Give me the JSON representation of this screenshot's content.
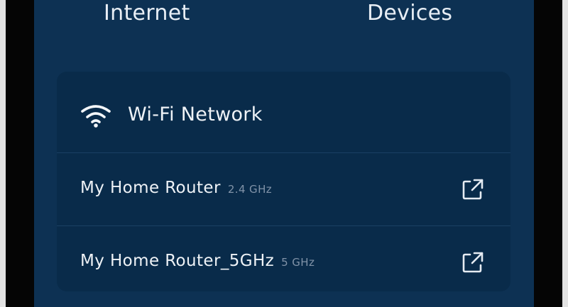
{
  "header": {
    "tabs": [
      {
        "label": "Internet"
      },
      {
        "label": "Devices"
      }
    ]
  },
  "wifi_card": {
    "title": "Wi-Fi Network",
    "icon": "wifi-icon",
    "networks": [
      {
        "name": "My Home Router",
        "band": "2.4 GHz",
        "action_icon": "external-link-icon"
      },
      {
        "name": "My Home Router_5GHz",
        "band": "5 GHz",
        "action_icon": "external-link-icon"
      }
    ]
  },
  "colors": {
    "screen_background": "#0d3153",
    "card_background": "#092b4a",
    "primary_text": "#eef2f6",
    "secondary_text": "#8193a8"
  }
}
